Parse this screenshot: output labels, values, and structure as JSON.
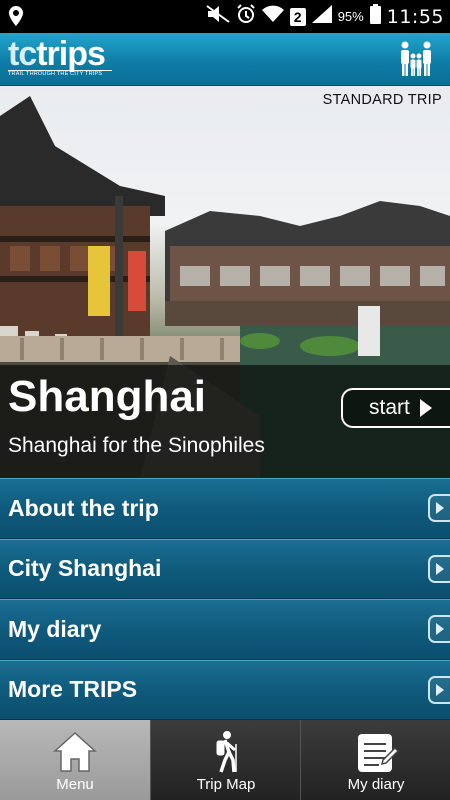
{
  "status_bar": {
    "battery_percent": "95%",
    "time": "11:55",
    "sim_slot": "2"
  },
  "header": {
    "logo_text": "trips",
    "logo_prefix": "tc",
    "logo_tagline": "TRAIL THROUGH THE CITY TRIPS",
    "family_icon": "family-icon"
  },
  "hero": {
    "trip_type": "STANDARD TRIP",
    "city": "Shanghai",
    "subtitle": "Shanghai for the Sinophiles",
    "start_label": "start"
  },
  "menu": {
    "items": [
      {
        "label": "About the trip"
      },
      {
        "label": "City Shanghai"
      },
      {
        "label": "My diary"
      },
      {
        "label": "More TRIPS"
      }
    ]
  },
  "bottom_nav": {
    "tabs": [
      {
        "label": "Menu",
        "icon": "home-icon",
        "active": true
      },
      {
        "label": "Trip Map",
        "icon": "hiker-icon",
        "active": false
      },
      {
        "label": "My diary",
        "icon": "diary-icon",
        "active": false
      }
    ]
  },
  "colors": {
    "header_blue": "#148cb8",
    "menu_blue": "#0f5a7c",
    "nav_active": "#a8a8a8",
    "nav_dark": "#2a2a2a"
  }
}
